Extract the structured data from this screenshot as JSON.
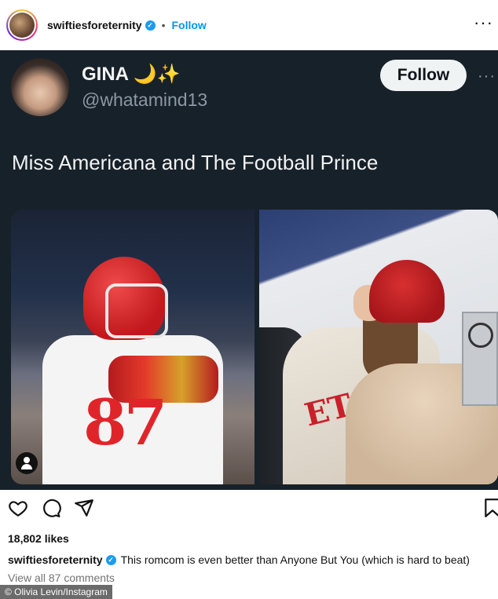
{
  "header": {
    "username": "swiftiesforeternity",
    "separator": "•",
    "follow_label": "Follow",
    "more_label": "···"
  },
  "tweet": {
    "name": "GINA",
    "name_emoji": "🌙✨",
    "handle": "@whatamind13",
    "follow_label": "Follow",
    "more_label": "···",
    "text": "Miss Americana and The Football Prince"
  },
  "photos": {
    "left_jersey_number": "87",
    "right_jacket_letters": "ET"
  },
  "actions": {
    "icons": [
      "heart-icon",
      "comment-icon",
      "share-icon",
      "bookmark-icon"
    ]
  },
  "post": {
    "likes": "18,802 likes",
    "caption_user": "swiftiesforeternity",
    "caption_text": "This romcom is even better than Anyone But You (which is hard to beat)",
    "view_comments": "View all 87 comments"
  },
  "credit": "© Olivia Levin/Instagram",
  "colors": {
    "accent_blue": "#0095f6",
    "verified_blue": "#1d9bf0",
    "tweet_bg": "#172129"
  }
}
